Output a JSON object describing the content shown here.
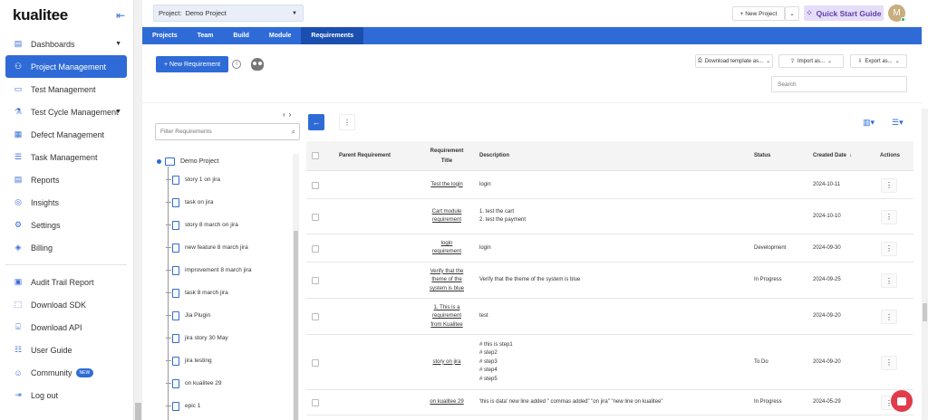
{
  "app": {
    "logo": "kualitee"
  },
  "sidebar": {
    "items": [
      {
        "label": "Dashboards",
        "icon": "dashboard-icon",
        "caret": true
      },
      {
        "label": "Project Management",
        "icon": "project-icon",
        "active": true
      },
      {
        "label": "Test Management",
        "icon": "test-icon"
      },
      {
        "label": "Test Cycle Management",
        "icon": "cycle-icon",
        "caret": true
      },
      {
        "label": "Defect Management",
        "icon": "defect-icon"
      },
      {
        "label": "Task Management",
        "icon": "task-icon"
      },
      {
        "label": "Reports",
        "icon": "reports-icon"
      },
      {
        "label": "Insights",
        "icon": "insights-icon"
      },
      {
        "label": "Settings",
        "icon": "settings-icon"
      },
      {
        "label": "Billing",
        "icon": "billing-icon"
      }
    ],
    "items2": [
      {
        "label": "Audit Trail Report",
        "icon": "audit-icon"
      },
      {
        "label": "Download SDK",
        "icon": "sdk-icon"
      },
      {
        "label": "Download API",
        "icon": "api-icon"
      },
      {
        "label": "User Guide",
        "icon": "guide-icon"
      },
      {
        "label": "Community",
        "icon": "community-icon",
        "badge": "NEW"
      },
      {
        "label": "Log out",
        "icon": "logout-icon"
      }
    ]
  },
  "topbar": {
    "project_label": "Project:",
    "project_value": "Demo Project",
    "new_project": "New Project",
    "quick_start": "Quick Start Guide",
    "avatar_letter": "M"
  },
  "tabs": [
    "Projects",
    "Team",
    "Build",
    "Module",
    "Requirements"
  ],
  "actions": {
    "new_requirement": "+ New Requirement",
    "download_template": "Download template as...",
    "import": "Import as...",
    "export": "Export as...",
    "search_placeholder": "Search"
  },
  "tree": {
    "filter_placeholder": "Filter Requirements",
    "root": "Demo Project",
    "items": [
      "story 1 on jira",
      "task on jira",
      "story 8 march on jira",
      "new feature 8 march jira",
      "improvement 8 march jira",
      "task 8 march jira",
      "Jia Plugin",
      "jira story 30 May",
      "jira testing",
      "on kualitee 29",
      "epic 1"
    ]
  },
  "table": {
    "headers": {
      "parent": "Parent Requirement",
      "title": "Requirement Title",
      "description": "Description",
      "status": "Status",
      "created": "Created Date",
      "actions": "Actions"
    },
    "rows": [
      {
        "title": "Test the login",
        "description": [
          "login"
        ],
        "status": "",
        "date": "2024-10-11"
      },
      {
        "title": "Cart module requirement",
        "description": [
          "1. test the cart",
          "2. test the payment"
        ],
        "status": "",
        "date": "2024-10-10"
      },
      {
        "title": "login requirement",
        "description": [
          "login"
        ],
        "status": "Development",
        "date": "2024-09-30"
      },
      {
        "title": "Verify that the theme of the system is blue",
        "description": [
          "Verify that the theme of the system is blue"
        ],
        "status": "In Progress",
        "date": "2024-09-25"
      },
      {
        "title": "1. This is a requirement from Kualitee",
        "description": [
          "test"
        ],
        "status": "",
        "date": "2024-09-20"
      },
      {
        "title": "story on jira",
        "description": [
          "# this is step1",
          "# step2",
          "# step3",
          "# step4",
          "# step5"
        ],
        "status": "To Do",
        "date": "2024-09-20"
      },
      {
        "title": "on kualitee 29",
        "description": [
          "'this is data' new line added \" commas added\" \"on jira\" \"new line on kualitee\""
        ],
        "status": "In Progress",
        "date": "2024-05-29"
      }
    ]
  }
}
